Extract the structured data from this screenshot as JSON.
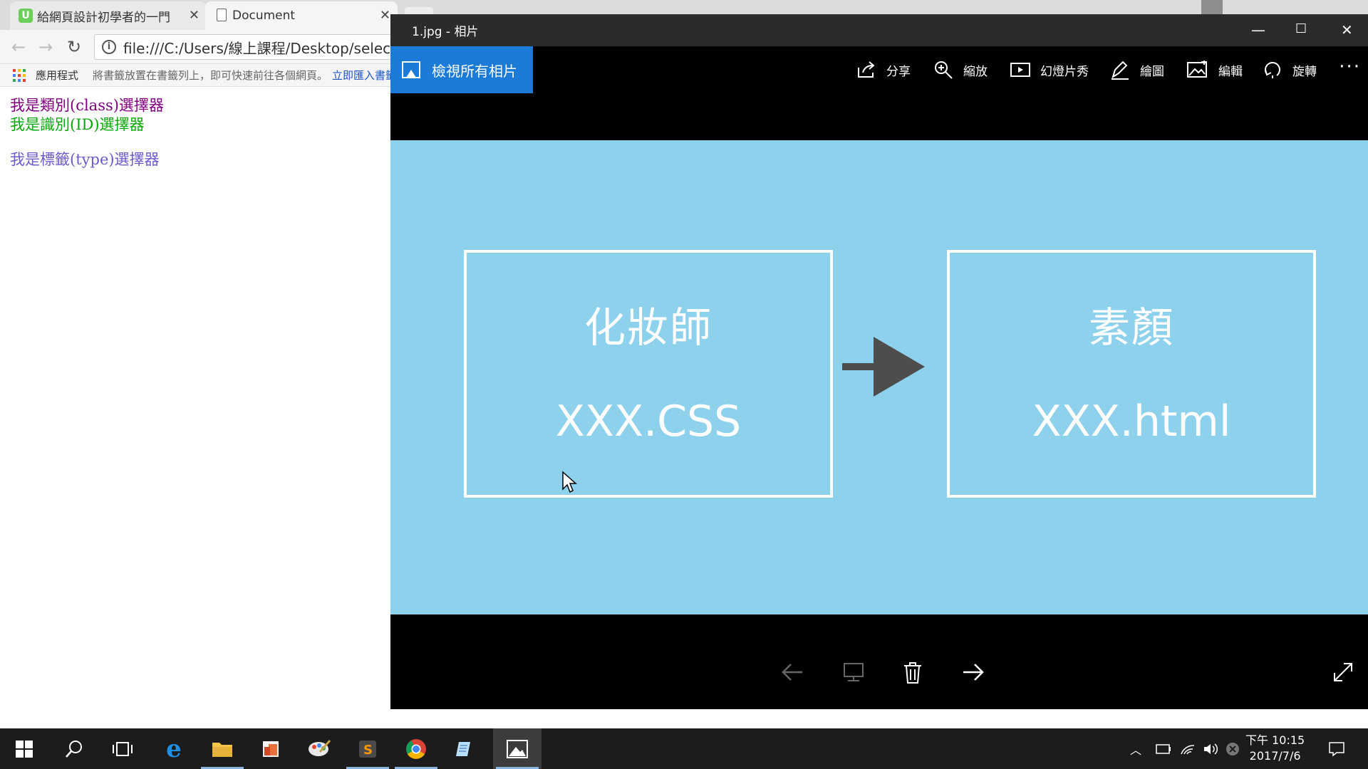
{
  "browser": {
    "tabs": [
      {
        "label": "給網頁設計初學者的一門",
        "favicon": "U"
      },
      {
        "label": "Document"
      }
    ],
    "address": "file:///C:/Users/線上課程/Desktop/selector",
    "bookmarks": {
      "apps_label": "應用程式",
      "hint": "將書籤放置在書籤列上，即可快速前往各個網頁。",
      "link": "立即匯入書籤..."
    },
    "content": {
      "class_text": "我是類別(class)選擇器",
      "id_text": "我是識別(ID)選擇器",
      "type_text": "我是標籤(type)選擇器"
    }
  },
  "photos": {
    "title": "1.jpg - 相片",
    "view_all": "檢視所有相片",
    "commands": {
      "share": "分享",
      "zoom": "縮放",
      "slideshow": "幻燈片秀",
      "draw": "繪圖",
      "edit": "編輯",
      "rotate": "旋轉"
    },
    "slide": {
      "left_title": "化妝師",
      "left_file": "XXX.CSS",
      "right_title": "素顏",
      "right_file": "XXX.html",
      "background": "#8ed1ec"
    }
  },
  "taskbar": {
    "time": "下午 10:15",
    "date": "2017/7/6"
  }
}
